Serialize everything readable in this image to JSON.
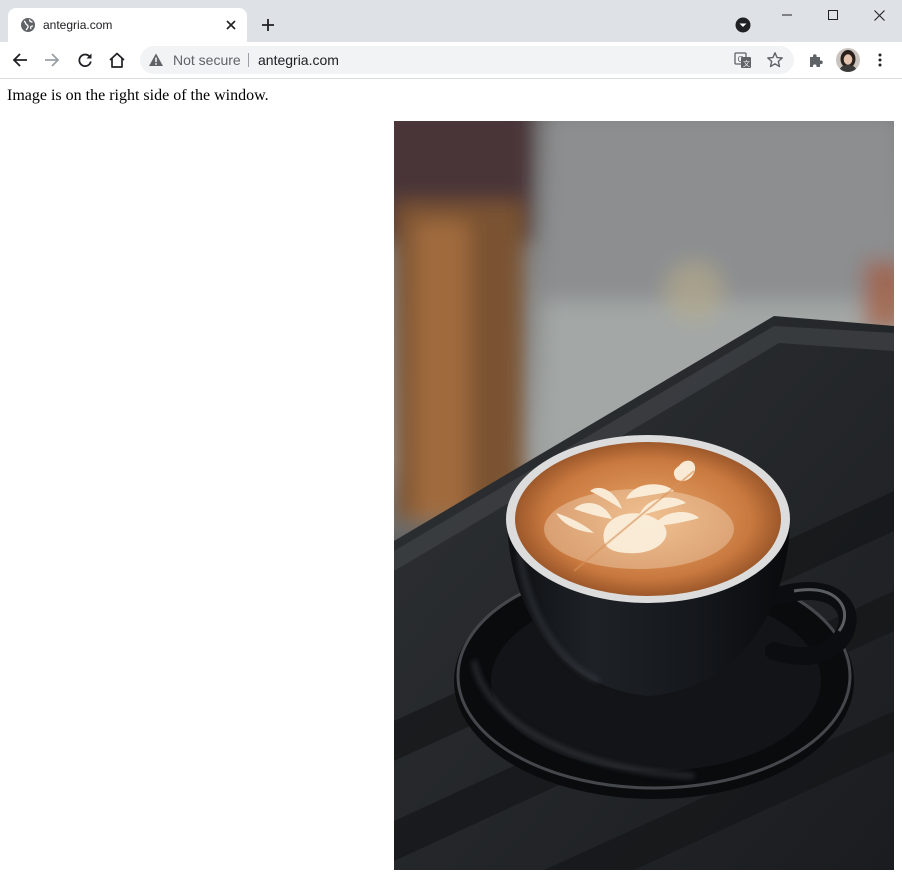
{
  "browser": {
    "tab": {
      "title": "antegria.com",
      "favicon": "globe-icon",
      "close_icon": "close-icon"
    },
    "new_tab_icon": "plus-icon",
    "tab_search_icon": "chevron-down-icon",
    "window_controls": [
      "minimize-icon",
      "maximize-icon",
      "close-icon"
    ],
    "toolbar": {
      "back_icon": "arrow-left-icon",
      "forward_icon": "arrow-right-icon",
      "reload_icon": "reload-icon",
      "home_icon": "home-icon",
      "security_icon": "warning-icon",
      "security_text": "Not secure",
      "url": "antegria.com",
      "translate_icon": "translate-icon",
      "bookmark_icon": "star-icon",
      "extensions_icon": "puzzle-icon",
      "profile": "avatar",
      "menu_icon": "more-vert-icon"
    },
    "colors": {
      "tabstrip_bg": "#dee1e6",
      "omnibox_bg": "#f1f3f4",
      "icon": "#5f6368"
    }
  },
  "page": {
    "text": "Image is on the right side of the window.",
    "image": "coffee-cup-photo"
  }
}
